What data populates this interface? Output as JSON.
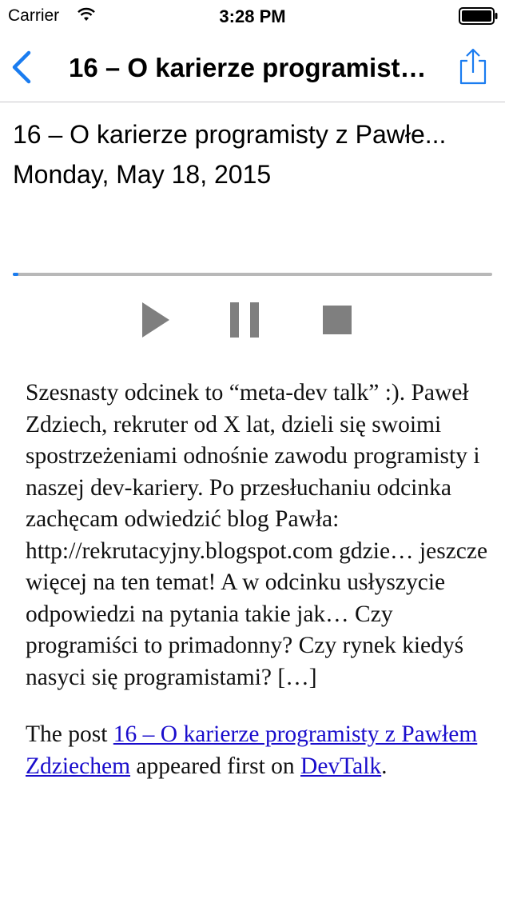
{
  "status_bar": {
    "carrier": "Carrier",
    "time": "3:28 PM"
  },
  "nav": {
    "title": "16 – O karierze programist…",
    "back_icon": "chevron-left-icon",
    "share_icon": "share-icon"
  },
  "episode": {
    "title": "16 – O karierze programisty z Pawłe...",
    "date": "Monday, May 18, 2015"
  },
  "player": {
    "progress": 0.012,
    "accent_color": "#1a7cf0",
    "controls": [
      "play-icon",
      "pause-icon",
      "stop-icon"
    ]
  },
  "description": {
    "paragraph": "Szesnasty odcinek to “meta-dev talk” :). Paweł Zdziech, rekruter od X lat, dzieli się swoimi spostrzeżeniami odnośnie zawodu programisty i naszej dev-kariery. Po przesłuchaniu odcinka zachęcam odwiedzić blog Pawła: http://rekrutacyjny.blogspot.com gdzie… jeszcze więcej na ten temat! A w odcinku usłyszycie odpowiedzi na pytania takie jak… Czy programiści to primadonny? Czy rynek kiedyś nasyci się programistami? […]",
    "footer_prefix": "The post ",
    "footer_link": "16 – O karierze programisty z Pawłem Zdziechem",
    "footer_middle": " appeared first on ",
    "footer_site": "DevTalk",
    "footer_suffix": "."
  }
}
